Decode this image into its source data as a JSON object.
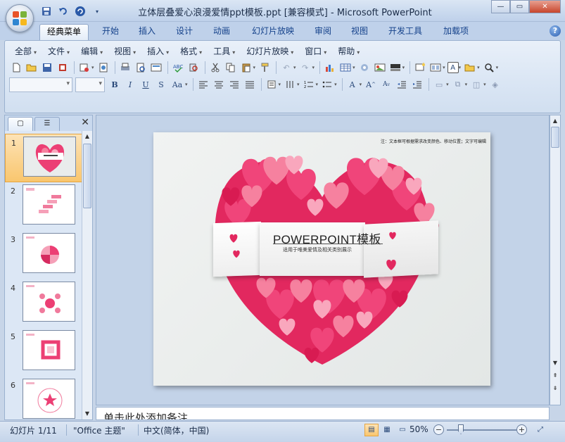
{
  "window": {
    "title": "立体层叠爱心浪漫爱情ppt模板.ppt [兼容模式] - Microsoft PowerPoint",
    "minimize": "—",
    "maximize": "▭",
    "close": "✕"
  },
  "qat": {
    "items": [
      "save-icon",
      "undo-icon",
      "redo-icon",
      "customize-icon"
    ]
  },
  "tabs": [
    "经典菜单",
    "开始",
    "插入",
    "设计",
    "动画",
    "幻灯片放映",
    "审阅",
    "视图",
    "开发工具",
    "加载项"
  ],
  "active_tab": "经典菜单",
  "menubar": [
    "全部",
    "文件",
    "编辑",
    "视图",
    "插入",
    "格式",
    "工具",
    "幻灯片放映",
    "窗口",
    "帮助"
  ],
  "left_pane": {
    "tab_slides_glyph": "▢",
    "tab_outline_glyph": "☰",
    "close_glyph": "✕",
    "slide_numbers": [
      "1",
      "2",
      "3",
      "4",
      "5",
      "6"
    ],
    "selected_slide": "1"
  },
  "slide": {
    "note": "注：文本框可根据需求改变颜色、移动位置；文字可编辑",
    "title": "POWERPOINT模板",
    "subtitle": "适用于唯美爱情及相关类别展示",
    "colors": {
      "heart_dark": "#e2285f",
      "heart_mid": "#f0457a",
      "heart_light": "#f6819f",
      "heart_pale": "#f9a7bd",
      "background": "#eceeed"
    }
  },
  "notes": {
    "text": "单击此处添加备注"
  },
  "statusbar": {
    "slide_info": "幻灯片 1/11",
    "theme": "\"Office 主题\"",
    "language": "中文(简体，中国)",
    "zoom": "50%",
    "zoom_out": "−",
    "zoom_in": "+"
  },
  "accent": {
    "ribbon_blue": "#15428b",
    "selection_orange": "#f9c66e"
  }
}
